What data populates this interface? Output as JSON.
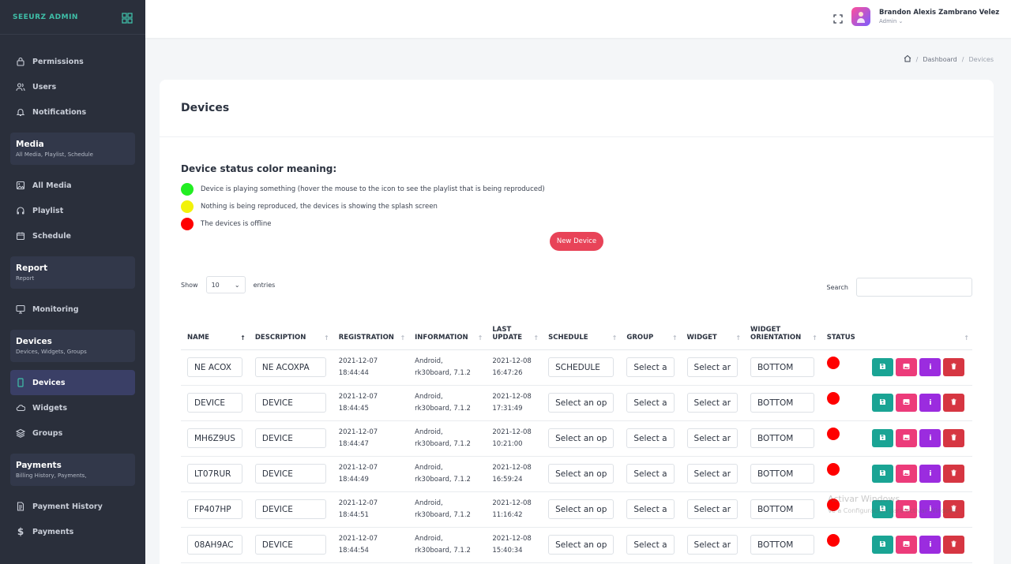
{
  "sidebar": {
    "brand": "SEEURZ ADMIN",
    "items_top": [
      {
        "label": "Permissions",
        "icon": "lock-icon"
      },
      {
        "label": "Users",
        "icon": "users-icon"
      },
      {
        "label": "Notifications",
        "icon": "bell-icon"
      }
    ],
    "media_section": {
      "title": "Media",
      "sub": "All Media, Playlist, Schedule"
    },
    "media_items": [
      {
        "label": "All Media",
        "icon": "image-icon"
      },
      {
        "label": "Playlist",
        "icon": "headphones-icon"
      },
      {
        "label": "Schedule",
        "icon": "calendar-icon"
      }
    ],
    "report_section": {
      "title": "Report",
      "sub": "Report"
    },
    "report_items": [
      {
        "label": "Monitoring",
        "icon": "monitor-icon"
      }
    ],
    "devices_section": {
      "title": "Devices",
      "sub": "Devices, Widgets, Groups"
    },
    "devices_items": [
      {
        "label": "Devices",
        "icon": "tablet-icon"
      },
      {
        "label": "Widgets",
        "icon": "cloud-icon"
      },
      {
        "label": "Groups",
        "icon": "layers-icon"
      }
    ],
    "payments_section": {
      "title": "Payments",
      "sub": "Billing History, Payments,"
    },
    "payments_items": [
      {
        "label": "Payment History",
        "icon": "file-icon"
      },
      {
        "label": "Payments",
        "icon": "dollar-icon"
      }
    ]
  },
  "topbar": {
    "user_name": "Brandon Alexis Zambrano Velez",
    "user_role": "Admin"
  },
  "breadcrumb": {
    "dashboard": "Dashboard",
    "current": "Devices"
  },
  "card": {
    "title": "Devices"
  },
  "legend": {
    "title": "Device status color meaning:",
    "items": [
      {
        "color": "#22ee22",
        "text": "Device is playing something (hover the mouse to the icon to see the playlist that is being reproduced)"
      },
      {
        "color": "#f2f20a",
        "text": "Nothing is being reproduced, the devices is showing the splash screen"
      },
      {
        "color": "#ff0000",
        "text": "The devices is offline"
      }
    ]
  },
  "new_device_label": "New Device",
  "table_controls": {
    "show": "Show",
    "entries_value": "10",
    "entries": "entries",
    "search": "Search"
  },
  "table": {
    "headers": {
      "name": "NAME",
      "description": "DESCRIPTION",
      "registration": "REGISTRATION",
      "information": "INFORMATION",
      "last_update_1": "LAST",
      "last_update_2": "UPDATE",
      "schedule": "SCHEDULE",
      "group": "GROUP",
      "widget": "WIDGET",
      "orientation_1": "WIDGET",
      "orientation_2": "ORIENTATION",
      "status": "STATUS"
    },
    "rows": [
      {
        "name": "NE ACOX",
        "description": "NE ACOXPA",
        "reg_date": "2021-12-07",
        "reg_time": "18:44:44",
        "info_1": "Android,",
        "info_2": "rk30board, 7.1.2",
        "upd_date": "2021-12-08",
        "upd_time": "16:47:26",
        "schedule": "SCHEDULE",
        "group": "Select a",
        "widget": "Select ar",
        "orientation": "BOTTOM"
      },
      {
        "name": "DEVICE",
        "description": "DEVICE",
        "reg_date": "2021-12-07",
        "reg_time": "18:44:45",
        "info_1": "Android,",
        "info_2": "rk30board, 7.1.2",
        "upd_date": "2021-12-08",
        "upd_time": "17:31:49",
        "schedule": "Select an op",
        "group": "Select a",
        "widget": "Select ar",
        "orientation": "BOTTOM"
      },
      {
        "name": "MH6Z9US",
        "description": "DEVICE",
        "reg_date": "2021-12-07",
        "reg_time": "18:44:47",
        "info_1": "Android,",
        "info_2": "rk30board, 7.1.2",
        "upd_date": "2021-12-08",
        "upd_time": "10:21:00",
        "schedule": "Select an op",
        "group": "Select a",
        "widget": "Select ar",
        "orientation": "BOTTOM"
      },
      {
        "name": "LT07RUR",
        "description": "DEVICE",
        "reg_date": "2021-12-07",
        "reg_time": "18:44:49",
        "info_1": "Android,",
        "info_2": "rk30board, 7.1.2",
        "upd_date": "2021-12-08",
        "upd_time": "16:59:24",
        "schedule": "Select an op",
        "group": "Select a",
        "widget": "Select ar",
        "orientation": "BOTTOM"
      },
      {
        "name": "FP407HP",
        "description": "DEVICE",
        "reg_date": "2021-12-07",
        "reg_time": "18:44:51",
        "info_1": "Android,",
        "info_2": "rk30board, 7.1.2",
        "upd_date": "2021-12-08",
        "upd_time": "11:16:42",
        "schedule": "Select an op",
        "group": "Select a",
        "widget": "Select ar",
        "orientation": "BOTTOM"
      },
      {
        "name": "08AH9AC",
        "description": "DEVICE",
        "reg_date": "2021-12-07",
        "reg_time": "18:44:54",
        "info_1": "Android,",
        "info_2": "rk30board, 7.1.2",
        "upd_date": "2021-12-08",
        "upd_time": "15:40:34",
        "schedule": "Select an op",
        "group": "Select a",
        "widget": "Select ar",
        "orientation": "BOTTOM"
      }
    ]
  },
  "watermark": {
    "line1": "Activar Windows",
    "line2": "Ve a Configuración para activar Windows."
  }
}
